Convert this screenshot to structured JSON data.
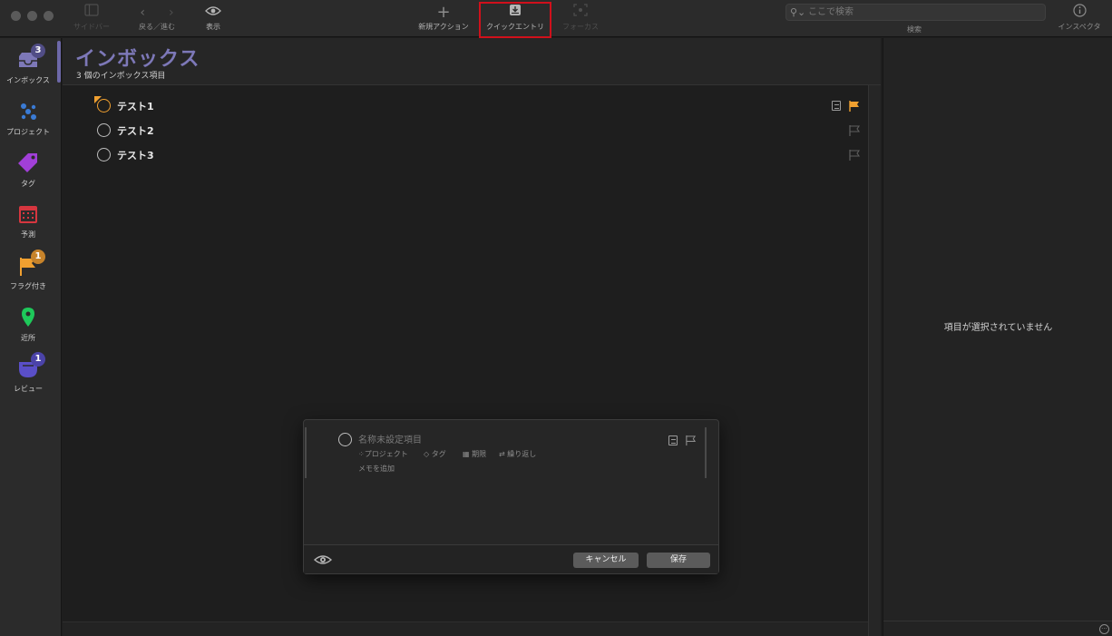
{
  "toolbar": {
    "sidebar_label": "サイドバー",
    "back_forward_label": "戻る／進む",
    "view_label": "表示",
    "new_action_label": "新規アクション",
    "quick_entry_label": "クイックエントリ",
    "focus_label": "フォーカス",
    "search_placeholder": "ここで検索",
    "search_label": "検索",
    "inspector_label": "インスペクタ",
    "highlight_color": "#d0101b"
  },
  "sidebar": {
    "items": [
      {
        "label": "インボックス",
        "badge": "3",
        "icon": "inbox-icon"
      },
      {
        "label": "プロジェクト",
        "icon": "projects-icon"
      },
      {
        "label": "タグ",
        "icon": "tag-icon"
      },
      {
        "label": "予測",
        "icon": "forecast-icon"
      },
      {
        "label": "フラグ付き",
        "badge": "1",
        "icon": "flag-icon"
      },
      {
        "label": "近所",
        "icon": "location-pin-icon"
      },
      {
        "label": "レビュー",
        "badge": "1",
        "icon": "review-icon"
      }
    ]
  },
  "main": {
    "title": "インボックス",
    "subtitle": "3 個のインボックス項目",
    "accent_color": "#7d78b8",
    "rows": [
      {
        "title": "テスト1",
        "flagged": true
      },
      {
        "title": "テスト2",
        "flagged": false
      },
      {
        "title": "テスト3",
        "flagged": false
      }
    ]
  },
  "inspector": {
    "empty_text": "項目が選択されていません"
  },
  "quick_entry": {
    "placeholder": "名称未設定項目",
    "project": "プロジェクト",
    "tag": "タグ",
    "due": "期限",
    "repeat": "繰り返し",
    "add_memo": "メモを追加",
    "cancel": "キャンセル",
    "save": "保存"
  }
}
